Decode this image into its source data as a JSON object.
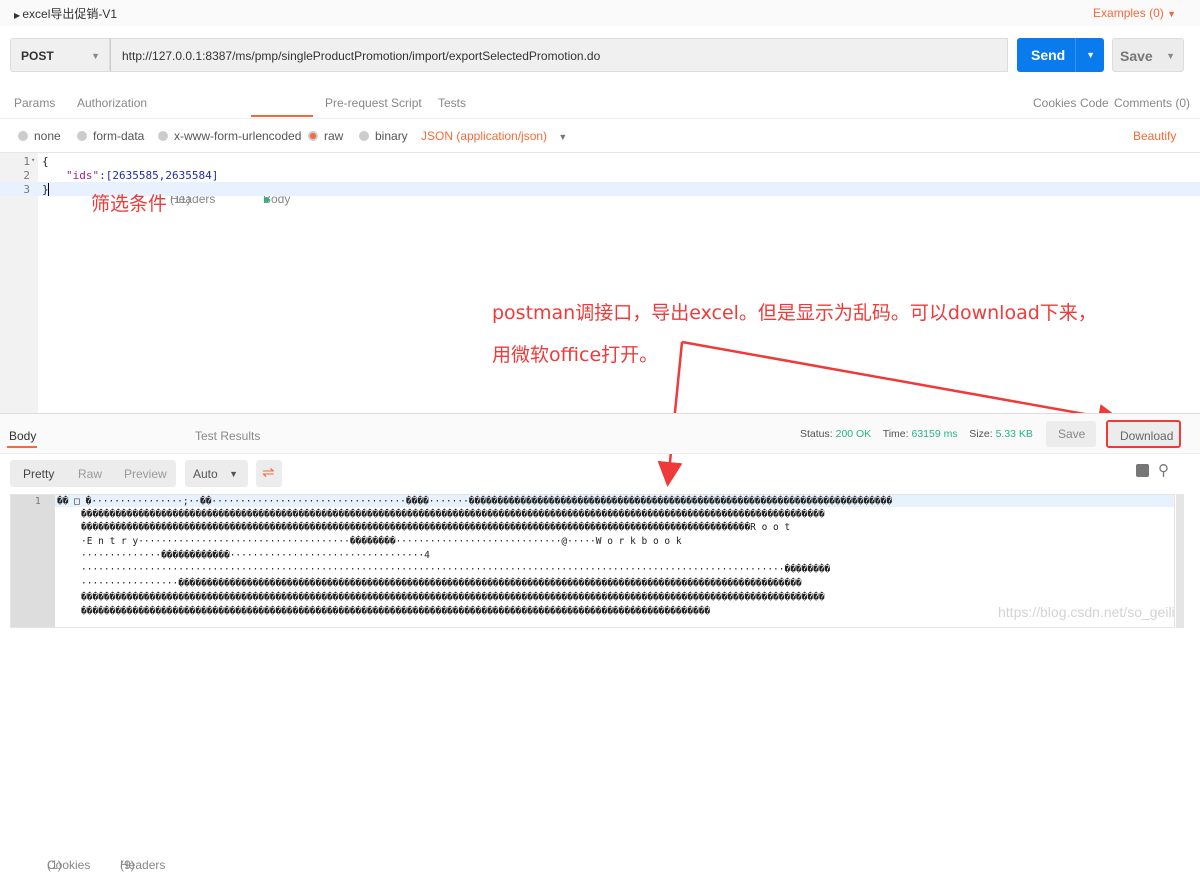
{
  "request": {
    "title": "excel导出促销-V1",
    "examples": "Examples (0)",
    "method": "POST",
    "url": "http://127.0.0.1:8387/ms/pmp/singleProductPromotion/import/exportSelectedPromotion.do",
    "send": "Send",
    "save": "Save"
  },
  "tabs": {
    "params": "Params",
    "authorization": "Authorization",
    "headers": "Headers",
    "headers_count": "(11)",
    "body": "Body",
    "prerequest": "Pre-request Script",
    "tests": "Tests",
    "cookies": "Cookies",
    "code": "Code",
    "comments": "Comments (0)"
  },
  "body_types": {
    "none": "none",
    "form_data": "form-data",
    "urlencoded": "x-www-form-urlencoded",
    "raw": "raw",
    "binary": "binary",
    "content_type": "JSON (application/json)",
    "beautify": "Beautify",
    "selected": "raw"
  },
  "code": {
    "lines": [
      {
        "n": "1",
        "text": "{"
      },
      {
        "n": "2",
        "key": "\"ids\"",
        "rest": ":[2635585,2635584]"
      },
      {
        "n": "3",
        "text": "}"
      }
    ]
  },
  "annotations": {
    "filter": "筛选条件",
    "note1": "postman调接口，导出excel。但是显示为乱码。可以download下来，",
    "note2": "用微软office打开。"
  },
  "response": {
    "tabs": {
      "body": "Body",
      "cookies": "Cookies",
      "cookies_count": "(1)",
      "headers": "Headers",
      "headers_count": "(9)",
      "tests": "Test Results"
    },
    "status_label": "Status:",
    "status": "200 OK",
    "time_label": "Time:",
    "time": "63159 ms",
    "size_label": "Size:",
    "size": "5.33 KB",
    "save": "Save",
    "download": "Download",
    "views": {
      "pretty": "Pretty",
      "raw": "Raw",
      "preview": "Preview",
      "format": "Auto"
    },
    "line_number": "1",
    "lines": [
      "�� □ �················;··��··································����·······��������������������������������������������������������������������������",
      "����������������������������������������������������������������������������������������������������������������������������������",
      "���������������������������������������������������������������������������������������������������������������������R o o t",
      "·E n t r y·····································��������·····························@·····W o r k b o o k",
      "··············������������··································4",
      "···························································································································��������",
      "·················�������������������������������������������������������������������������������������������������������������",
      "����������������������������������������������������������������������������������������������������������������������������������",
      "��������������������������������������������������������������������������������������������������������������"
    ]
  },
  "watermark": "https://blog.csdn.net/so_geili",
  "colors": {
    "accent": "#f26b3a",
    "send": "#097bed",
    "success": "#26b47f",
    "annotation": "#f03a3a"
  }
}
